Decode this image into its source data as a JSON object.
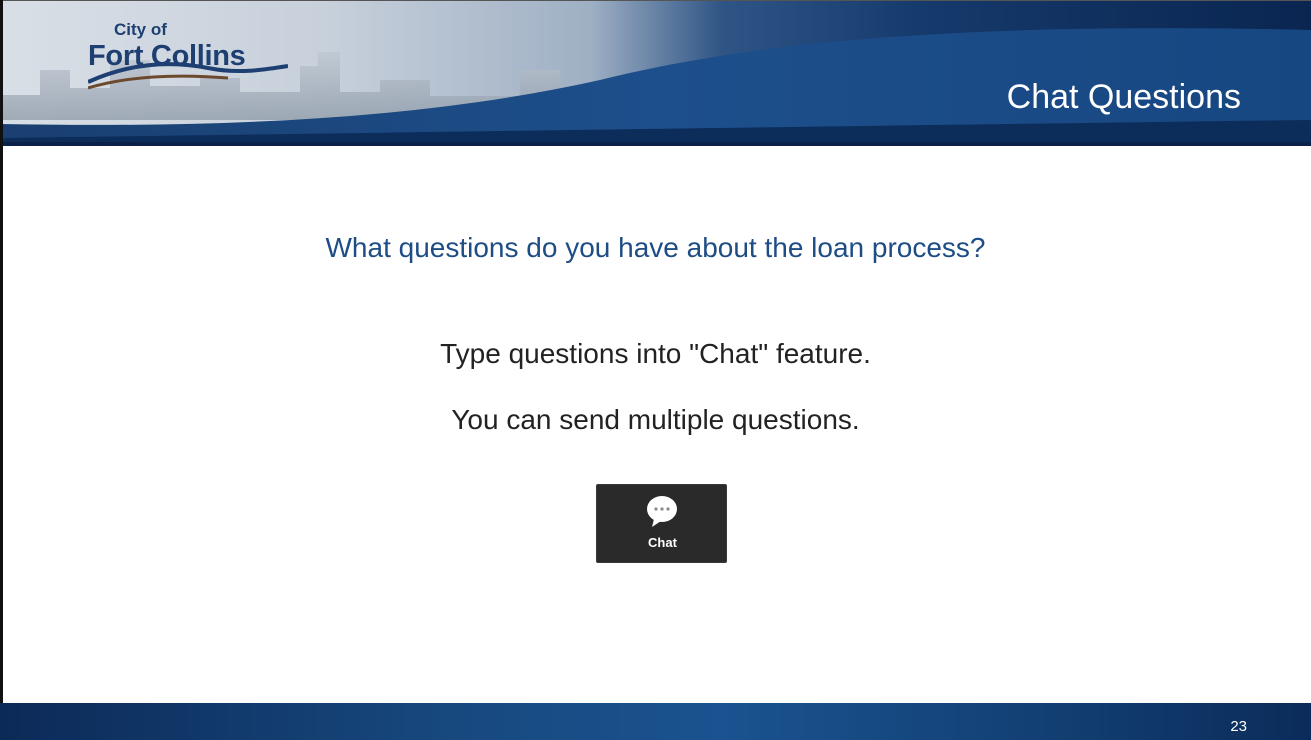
{
  "header": {
    "logo_small": "City of",
    "logo_main": "Fort Collins",
    "title": "Chat Questions"
  },
  "body": {
    "question": "What questions do you have about the loan process?",
    "line1": "Type questions into \"Chat\" feature.",
    "line2": "You can send multiple questions."
  },
  "chat_button": {
    "label": "Chat",
    "icon": "speech-bubble-icon"
  },
  "footer": {
    "page_number": "23"
  },
  "colors": {
    "header_navy": "#0e2d5c",
    "header_blue": "#1b4f8a",
    "accent_text": "#1e4d85",
    "chat_button_bg": "#2a2a2a"
  }
}
